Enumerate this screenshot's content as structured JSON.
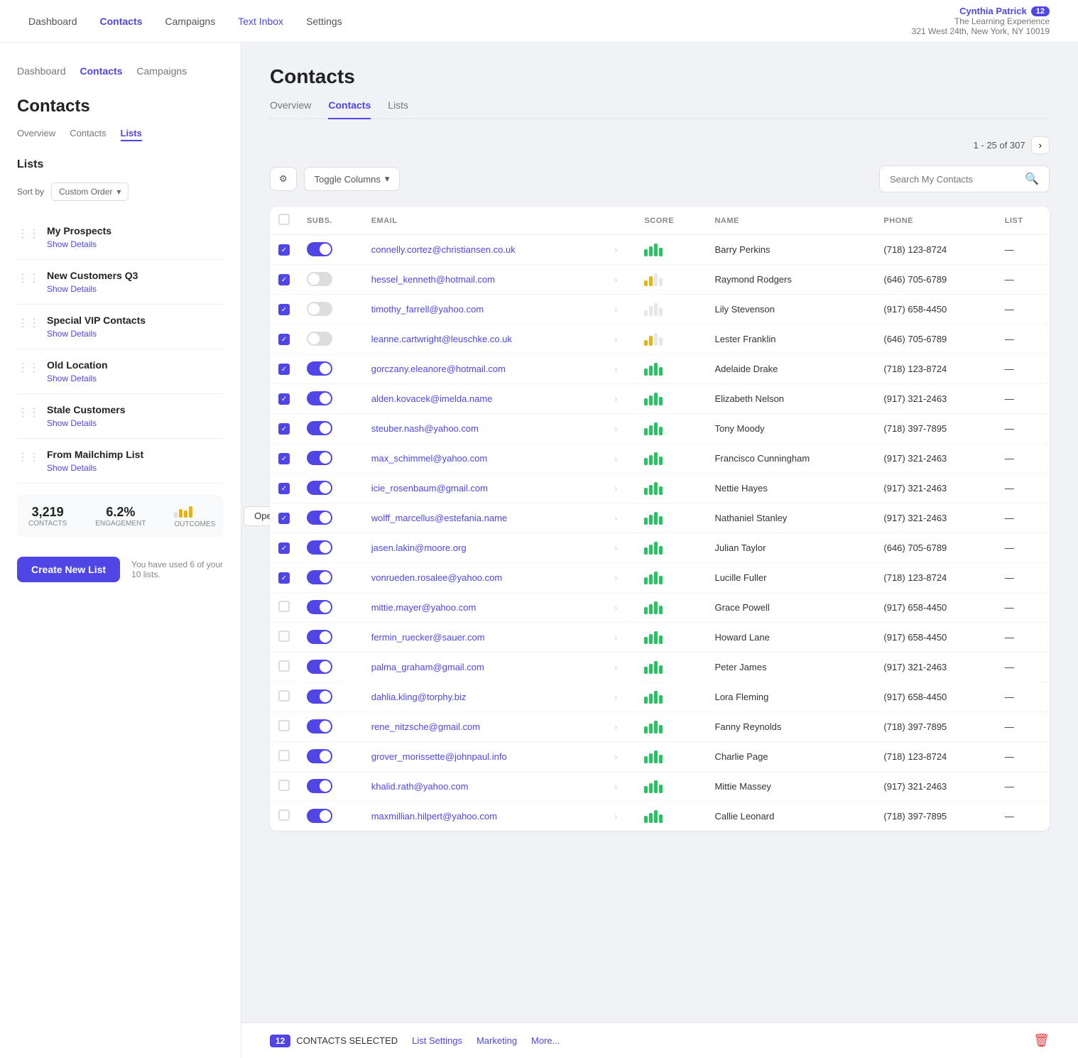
{
  "topNav": {
    "links": [
      {
        "label": "Dashboard",
        "active": false
      },
      {
        "label": "Contacts",
        "active": true
      },
      {
        "label": "Campaigns",
        "active": false
      },
      {
        "label": "Text Inbox",
        "active": false,
        "highlight": true
      },
      {
        "label": "Settings",
        "active": false
      }
    ],
    "user": {
      "name": "Cynthia Patrick",
      "badge": "12",
      "org": "The Learning Experience",
      "address": "321 West 24th, New York, NY 10019"
    }
  },
  "sidebar": {
    "nav": [
      {
        "label": "Dashboard",
        "active": false
      },
      {
        "label": "Contacts",
        "active": true
      },
      {
        "label": "Campaigns",
        "active": false
      }
    ],
    "title": "Contacts",
    "tabs": [
      {
        "label": "Overview",
        "active": false
      },
      {
        "label": "Contacts",
        "active": false
      },
      {
        "label": "Lists",
        "active": true
      }
    ],
    "listsTitle": "Lists",
    "sortLabel": "Sort by",
    "sortValue": "Custom Order",
    "lists": [
      {
        "name": "My Prospects",
        "detail": "Show Details"
      },
      {
        "name": "New Customers Q3",
        "detail": "Show Details"
      },
      {
        "name": "Special VIP Contacts",
        "detail": "Show Details"
      },
      {
        "name": "Old Location",
        "detail": "Show Details"
      },
      {
        "name": "Stale Customers",
        "detail": "Show Details"
      },
      {
        "name": "From Mailchimp List",
        "detail": "Show Details"
      }
    ],
    "createBtn": "Create New List",
    "usageText": "You have used 6 of your 10 lists.",
    "stats": {
      "contacts": "3,219",
      "contactsLabel": "CONTACTS",
      "engagement": "6.2%",
      "engagementLabel": "ENGAGEMENT",
      "outcomesLabel": "OUTCOMES",
      "openBtn": "Open"
    }
  },
  "main": {
    "title": "Contacts",
    "tabs": [
      {
        "label": "Overview",
        "active": false
      },
      {
        "label": "Contacts",
        "active": true
      },
      {
        "label": "Lists",
        "active": false
      }
    ],
    "pagination": "1 - 25 of 307",
    "toolbar": {
      "toggleColumns": "Toggle Columns",
      "searchPlaceholder": "Search My Contacts"
    },
    "table": {
      "headers": [
        "",
        "SUBS.",
        "EMAIL",
        "",
        "SCORE",
        "NAME",
        "PHONE",
        "LIST"
      ],
      "rows": [
        {
          "checked": true,
          "toggled": true,
          "email": "connelly.cortez@christiansen.co.uk",
          "scoreType": "green",
          "name": "Barry Perkins",
          "phone": "(718) 123-8724",
          "list": "—"
        },
        {
          "checked": true,
          "toggled": false,
          "email": "hessel_kenneth@hotmail.com",
          "scoreType": "mixed",
          "name": "Raymond Rodgers",
          "phone": "(646) 705-6789",
          "list": "—"
        },
        {
          "checked": true,
          "toggled": false,
          "email": "timothy_farrell@yahoo.com",
          "scoreType": "gray",
          "name": "Lily Stevenson",
          "phone": "(917) 658-4450",
          "list": "—"
        },
        {
          "checked": true,
          "toggled": false,
          "email": "leanne.cartwright@leuschke.co.uk",
          "scoreType": "yellow",
          "name": "Lester Franklin",
          "phone": "(646) 705-6789",
          "list": "—"
        },
        {
          "checked": true,
          "toggled": true,
          "email": "gorczany.eleanore@hotmail.com",
          "scoreType": "green",
          "name": "Adelaide Drake",
          "phone": "(718) 123-8724",
          "list": "—"
        },
        {
          "checked": true,
          "toggled": true,
          "email": "alden.kovacek@imelda.name",
          "scoreType": "green",
          "name": "Elizabeth Nelson",
          "phone": "(917) 321-2463",
          "list": "—"
        },
        {
          "checked": true,
          "toggled": true,
          "email": "steuber.nash@yahoo.com",
          "scoreType": "green",
          "name": "Tony Moody",
          "phone": "(718) 397-7895",
          "list": "—"
        },
        {
          "checked": true,
          "toggled": true,
          "email": "max_schimmel@yahoo.com",
          "scoreType": "green",
          "name": "Francisco Cunningham",
          "phone": "(917) 321-2463",
          "list": "—"
        },
        {
          "checked": true,
          "toggled": true,
          "email": "icie_rosenbaum@gmail.com",
          "scoreType": "green",
          "name": "Nettie Hayes",
          "phone": "(917) 321-2463",
          "list": "—"
        },
        {
          "checked": true,
          "toggled": true,
          "email": "wolff_marcellus@estefania.name",
          "scoreType": "green",
          "name": "Nathaniel Stanley",
          "phone": "(917) 321-2463",
          "list": "—"
        },
        {
          "checked": true,
          "toggled": true,
          "email": "jasen.lakin@moore.org",
          "scoreType": "green",
          "name": "Julian Taylor",
          "phone": "(646) 705-6789",
          "list": "—"
        },
        {
          "checked": true,
          "toggled": true,
          "email": "vonrueden.rosalee@yahoo.com",
          "scoreType": "green",
          "name": "Lucille Fuller",
          "phone": "(718) 123-8724",
          "list": "—"
        },
        {
          "checked": false,
          "toggled": true,
          "email": "mittie.mayer@yahoo.com",
          "scoreType": "green",
          "name": "Grace Powell",
          "phone": "(917) 658-4450",
          "list": "—"
        },
        {
          "checked": false,
          "toggled": true,
          "email": "fermin_ruecker@sauer.com",
          "scoreType": "green",
          "name": "Howard Lane",
          "phone": "(917) 658-4450",
          "list": "—"
        },
        {
          "checked": false,
          "toggled": true,
          "email": "palma_graham@gmail.com",
          "scoreType": "green",
          "name": "Peter James",
          "phone": "(917) 321-2463",
          "list": "—"
        },
        {
          "checked": false,
          "toggled": true,
          "email": "dahlia.kling@torphy.biz",
          "scoreType": "green",
          "name": "Lora Fleming",
          "phone": "(917) 658-4450",
          "list": "—"
        },
        {
          "checked": false,
          "toggled": true,
          "email": "rene_nitzsche@gmail.com",
          "scoreType": "green",
          "name": "Fanny Reynolds",
          "phone": "(718) 397-7895",
          "list": "—"
        },
        {
          "checked": false,
          "toggled": true,
          "email": "grover_morissette@johnpaul.info",
          "scoreType": "green",
          "name": "Charlie Page",
          "phone": "(718) 123-8724",
          "list": "—"
        },
        {
          "checked": false,
          "toggled": true,
          "email": "khalid.rath@yahoo.com",
          "scoreType": "green",
          "name": "Mittie Massey",
          "phone": "(917) 321-2463",
          "list": "—"
        },
        {
          "checked": false,
          "toggled": true,
          "email": "maxmillian.hilpert@yahoo.com",
          "scoreType": "green",
          "name": "Callie Leonard",
          "phone": "(718) 397-7895",
          "list": "—"
        }
      ]
    },
    "bottomBar": {
      "count": "12",
      "selectedLabel": "CONTACTS SELECTED",
      "actions": [
        "List Settings",
        "Marketing",
        "More..."
      ]
    }
  }
}
